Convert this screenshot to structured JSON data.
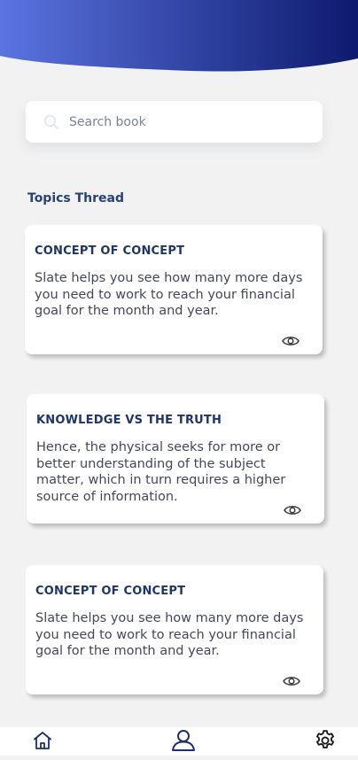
{
  "search": {
    "placeholder": "Search book"
  },
  "section": {
    "title": "Topics Thread"
  },
  "cards": [
    {
      "title": "CONCEPT OF CONCEPT",
      "body": "Slate helps you see how many more days you need to work to reach your financial goal for the month and year.",
      "icon": "eye-icon"
    },
    {
      "title": "KNOWLEDGE VS THE TRUTH",
      "body": "Hence, the physical seeks for more or better understanding of the subject matter, which in turn requires a higher source of information.",
      "icon": "eye-icon"
    },
    {
      "title": "CONCEPT OF CONCEPT",
      "body": "Slate helps you see how many more days you need to work to reach your financial goal for the month and year.",
      "icon": "eye-icon"
    }
  ],
  "nav": {
    "items": [
      "home-icon",
      "profile-icon",
      "settings-icon"
    ]
  },
  "colors": {
    "header_start": "#5b74e0",
    "header_end": "#0d1a6e",
    "heading": "#27427a",
    "nav_icon": "#1f2f6b"
  }
}
